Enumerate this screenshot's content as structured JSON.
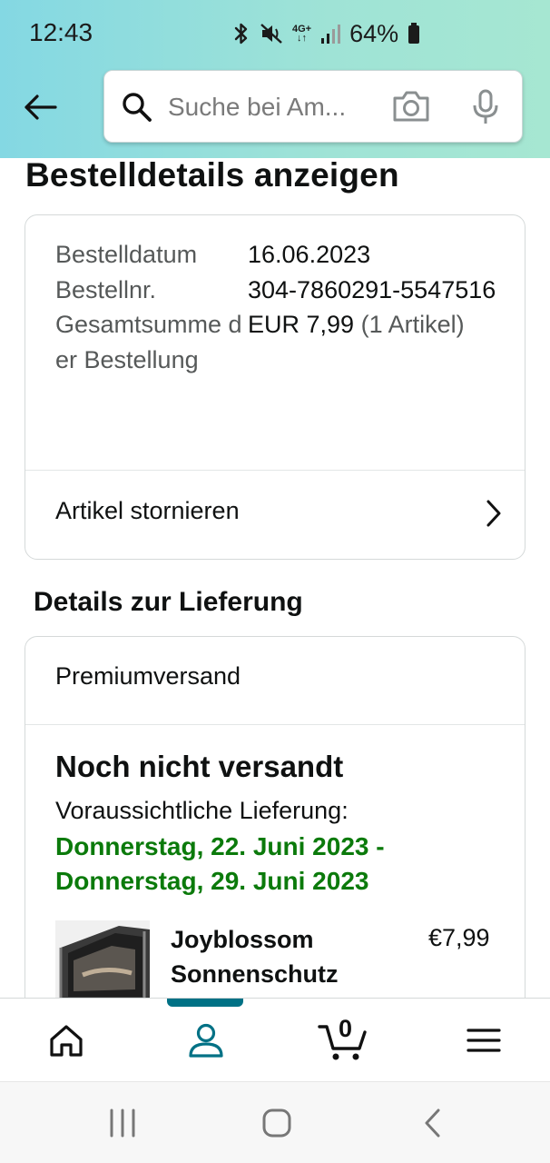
{
  "status_bar": {
    "time": "12:43",
    "network_top": "4G+",
    "battery_percent": "64%",
    "icons": [
      "bluetooth-icon",
      "mute-vibrate-icon",
      "4g-data-icon",
      "signal-icon",
      "battery-icon"
    ]
  },
  "header": {
    "search_placeholder": "Suche bei Am...",
    "icons": [
      "back-arrow-icon",
      "search-icon",
      "camera-icon",
      "microphone-icon"
    ]
  },
  "page": {
    "title": "Bestelldetails anzeigen"
  },
  "order_summary": {
    "date_label": "Bestelldatum",
    "date_value": "16.06.2023",
    "number_label": "Bestellnr.",
    "number_value": "304-7860291-5547516",
    "total_label": "Gesamtsumme der Bestellung",
    "total_value": "EUR 7,99",
    "total_items": "(1 Artikel)",
    "cancel_label": "Artikel stornieren"
  },
  "delivery": {
    "section_title": "Details zur Lieferung",
    "shipping_method": "Premiumversand",
    "status": "Noch nicht versandt",
    "eta_label": "Voraussichtliche Lieferung:",
    "eta_range": "Donnerstag, 22. Juni 2023 - Donnerstag, 29. Juni 2023",
    "product_name": "Joyblossom Sonnenschutz",
    "product_price": "€7,99"
  },
  "bottom_nav": {
    "cart_count": "0",
    "active_tab": "account",
    "icons": [
      "home-icon",
      "account-icon",
      "cart-icon",
      "menu-icon"
    ]
  },
  "system_nav": {
    "icons": [
      "recent-apps-icon",
      "home-button-icon",
      "back-icon"
    ]
  },
  "colors": {
    "header_gradient_start": "#84d8e3",
    "header_gradient_end": "#a6e7d2",
    "delivery_date_green": "#0b7a0b",
    "active_tab_accent": "#007185"
  }
}
